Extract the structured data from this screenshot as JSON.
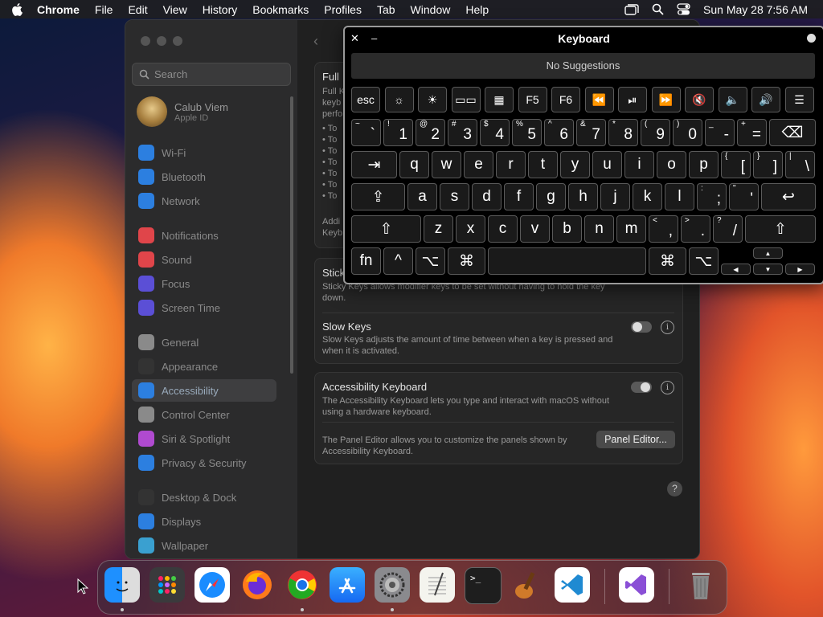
{
  "menubar": {
    "app_name": "Chrome",
    "items": [
      "File",
      "Edit",
      "View",
      "History",
      "Bookmarks",
      "Profiles",
      "Tab",
      "Window",
      "Help"
    ],
    "clock": "Sun May 28  7:56 AM",
    "icons": [
      "apple-icon",
      "window-icon",
      "search-icon",
      "control-center-icon"
    ]
  },
  "settings": {
    "search_placeholder": "Search",
    "profile": {
      "name": "Calub Viem",
      "subtitle": "Apple ID"
    },
    "sidebar": [
      {
        "label": "Wi-Fi",
        "icon": "wifi-icon",
        "color": "#2c7fe0"
      },
      {
        "label": "Bluetooth",
        "icon": "bluetooth-icon",
        "color": "#2c7fe0"
      },
      {
        "label": "Network",
        "icon": "globe-icon",
        "color": "#2c7fe0"
      },
      {
        "label": "Notifications",
        "icon": "bell-icon",
        "color": "#e0454a"
      },
      {
        "label": "Sound",
        "icon": "speaker-icon",
        "color": "#e0454a"
      },
      {
        "label": "Focus",
        "icon": "moon-icon",
        "color": "#5b4fd6"
      },
      {
        "label": "Screen Time",
        "icon": "hourglass-icon",
        "color": "#5b4fd6"
      },
      {
        "label": "General",
        "icon": "gear-icon",
        "color": "#8a8a8a"
      },
      {
        "label": "Appearance",
        "icon": "appearance-icon",
        "color": "#333"
      },
      {
        "label": "Accessibility",
        "icon": "accessibility-icon",
        "color": "#2c7fe0"
      },
      {
        "label": "Control Center",
        "icon": "control-center-icon",
        "color": "#8a8a8a"
      },
      {
        "label": "Siri & Spotlight",
        "icon": "siri-icon",
        "color": "#b04ad0"
      },
      {
        "label": "Privacy & Security",
        "icon": "hand-icon",
        "color": "#2c7fe0"
      },
      {
        "label": "Desktop & Dock",
        "icon": "dock-icon",
        "color": "#333"
      },
      {
        "label": "Displays",
        "icon": "display-icon",
        "color": "#2c7fe0"
      },
      {
        "label": "Wallpaper",
        "icon": "wallpaper-icon",
        "color": "#3aa0d0"
      }
    ],
    "active_item": "Accessibility",
    "full_card": {
      "title": "Full",
      "desc_lines": [
        "Full K",
        "keyb",
        "perfo"
      ],
      "bullets": [
        "• To",
        "• To",
        "• To",
        "• To",
        "• To",
        "• To",
        "• To"
      ],
      "footer": [
        "Addi",
        "Keyb"
      ]
    },
    "sticky_keys": {
      "title": "Stick",
      "desc": "Sticky Keys allows modifier keys to be set without having to hold the key down."
    },
    "slow_keys": {
      "title": "Slow Keys",
      "desc": "Slow Keys adjusts the amount of time between when a key is pressed and when it is activated.",
      "enabled": false
    },
    "accessibility_keyboard": {
      "title": "Accessibility Keyboard",
      "desc": "The Accessibility Keyboard lets you type and interact with macOS without using a hardware keyboard.",
      "enabled": true,
      "panel_desc": "The Panel Editor allows you to customize the panels shown by Accessibility Keyboard.",
      "panel_button": "Panel Editor..."
    },
    "help_label": "?"
  },
  "keyboard": {
    "title": "Keyboard",
    "close": "✕",
    "minimize": "–",
    "suggestions": "No Suggestions",
    "row_function": [
      "esc",
      "☼",
      "☀",
      "▭▭",
      "▦",
      "F5",
      "F6",
      "⏪",
      "⏯",
      "⏩",
      "🔇",
      "🔈",
      "🔊",
      "☰"
    ],
    "row_numbers": [
      {
        "up": "~",
        "lo": "`"
      },
      {
        "up": "!",
        "lo": "1"
      },
      {
        "up": "@",
        "lo": "2"
      },
      {
        "up": "#",
        "lo": "3"
      },
      {
        "up": "$",
        "lo": "4"
      },
      {
        "up": "%",
        "lo": "5"
      },
      {
        "up": "^",
        "lo": "6"
      },
      {
        "up": "&",
        "lo": "7"
      },
      {
        "up": "*",
        "lo": "8"
      },
      {
        "up": "(",
        "lo": "9"
      },
      {
        "up": ")",
        "lo": "0"
      },
      {
        "up": "_",
        "lo": "-"
      },
      {
        "up": "+",
        "lo": "="
      }
    ],
    "delete": "⌫",
    "tab": "⇥",
    "row_q": [
      "q",
      "w",
      "e",
      "r",
      "t",
      "y",
      "u",
      "i",
      "o",
      "p"
    ],
    "row_q_tail": [
      {
        "up": "{",
        "lo": "["
      },
      {
        "up": "}",
        "lo": "]"
      },
      {
        "up": "|",
        "lo": "\\"
      }
    ],
    "caps": "⇪",
    "row_a": [
      "a",
      "s",
      "d",
      "f",
      "g",
      "h",
      "j",
      "k",
      "l"
    ],
    "row_a_tail": [
      {
        "up": ":",
        "lo": ";"
      },
      {
        "up": "\"",
        "lo": "'"
      }
    ],
    "return": "↩",
    "shift": "⇧",
    "row_z": [
      "z",
      "x",
      "c",
      "v",
      "b",
      "n",
      "m"
    ],
    "row_z_tail": [
      {
        "up": "<",
        "lo": ","
      },
      {
        "up": ">",
        "lo": "."
      },
      {
        "up": "?",
        "lo": "/"
      }
    ],
    "bottom": {
      "fn": "fn",
      "ctrl": "^",
      "opt": "⌥",
      "cmd": "⌘",
      "space": ""
    },
    "arrows": {
      "up": "▲",
      "down": "▼",
      "left": "◀",
      "right": "▶"
    }
  },
  "dock": {
    "apps": [
      "Finder",
      "Launchpad",
      "Safari",
      "Firefox",
      "Chrome",
      "App Store",
      "System Settings",
      "TextEdit",
      "Terminal",
      "GarageBand",
      "Visual Studio Code",
      "Visual Studio",
      "Trash"
    ]
  }
}
